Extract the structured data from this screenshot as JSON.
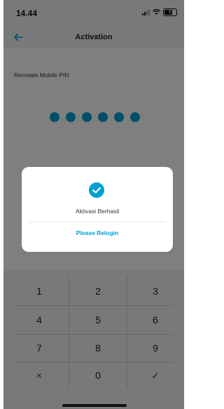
{
  "status_bar": {
    "time": "14.44",
    "battery": "6"
  },
  "header": {
    "title": "Activation"
  },
  "pin": {
    "label": "Recreate Mobile PIN",
    "filled_count": 6
  },
  "keypad": {
    "keys": [
      "1",
      "2",
      "3",
      "4",
      "5",
      "6",
      "7",
      "8",
      "9",
      "×",
      "0",
      "✓"
    ]
  },
  "dialog": {
    "message": "Aktivasi Berhasil",
    "action_label": "Please Relogin"
  },
  "colors": {
    "accent": "#00a0d1"
  }
}
